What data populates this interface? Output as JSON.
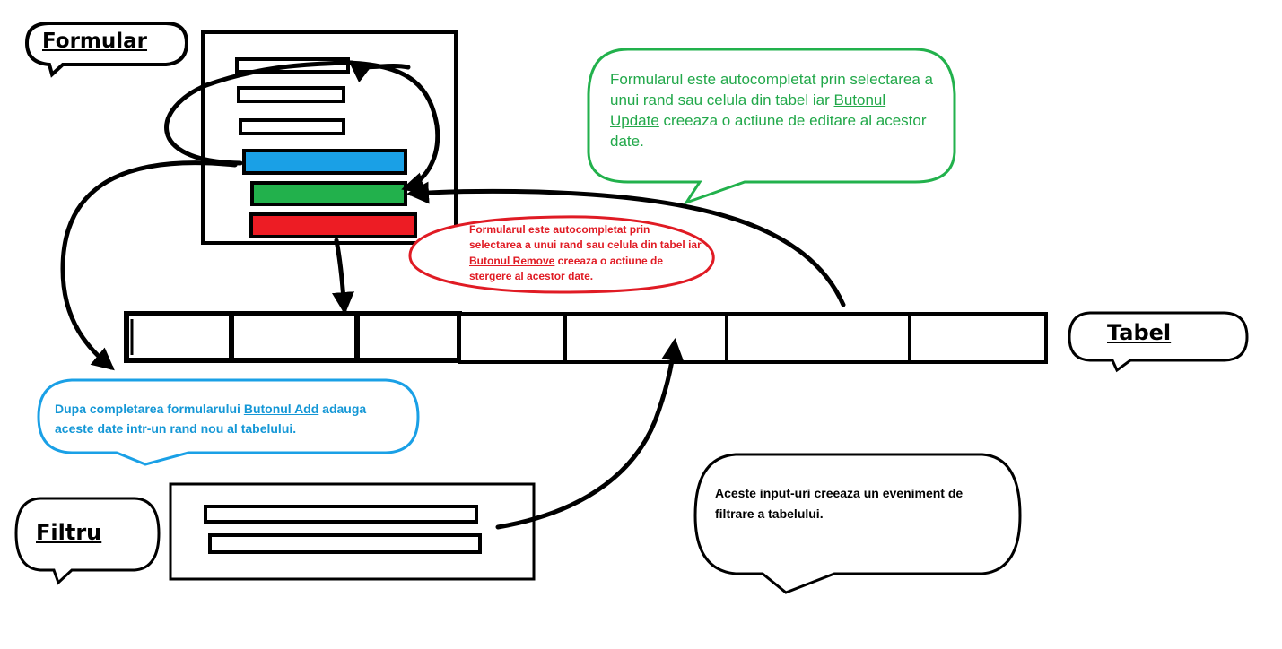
{
  "labels": {
    "formular": "Formular",
    "tabel": "Tabel",
    "filtru": "Filtru"
  },
  "notes": {
    "update": {
      "pre": "Formularul este autocompletat prin selectarea a unui rand sau celula din tabel iar ",
      "link": "Butonul Update",
      "post": " creeaza o actiune de editare al acestor date."
    },
    "remove": {
      "pre": "Formularul este autocompletat prin selectarea a unui rand sau celula din tabel iar ",
      "link": "Butonul Remove",
      "post": "  creeaza o actiune de stergere al acestor date."
    },
    "add": {
      "pre": "Dupa completarea formularului  ",
      "link": "Butonul Add",
      "post": " adauga aceste date intr-un rand nou al tabelului."
    },
    "filter": {
      "text": "Aceste input-uri creeaza un eveniment de filtrare a tabelului."
    }
  },
  "colors": {
    "add_button": "#1aa0e6",
    "update_button": "#22b14c",
    "remove_button": "#ed1c24",
    "update_note": "#22a84a",
    "remove_note": "#e01b24",
    "add_note": "#1497d6"
  }
}
